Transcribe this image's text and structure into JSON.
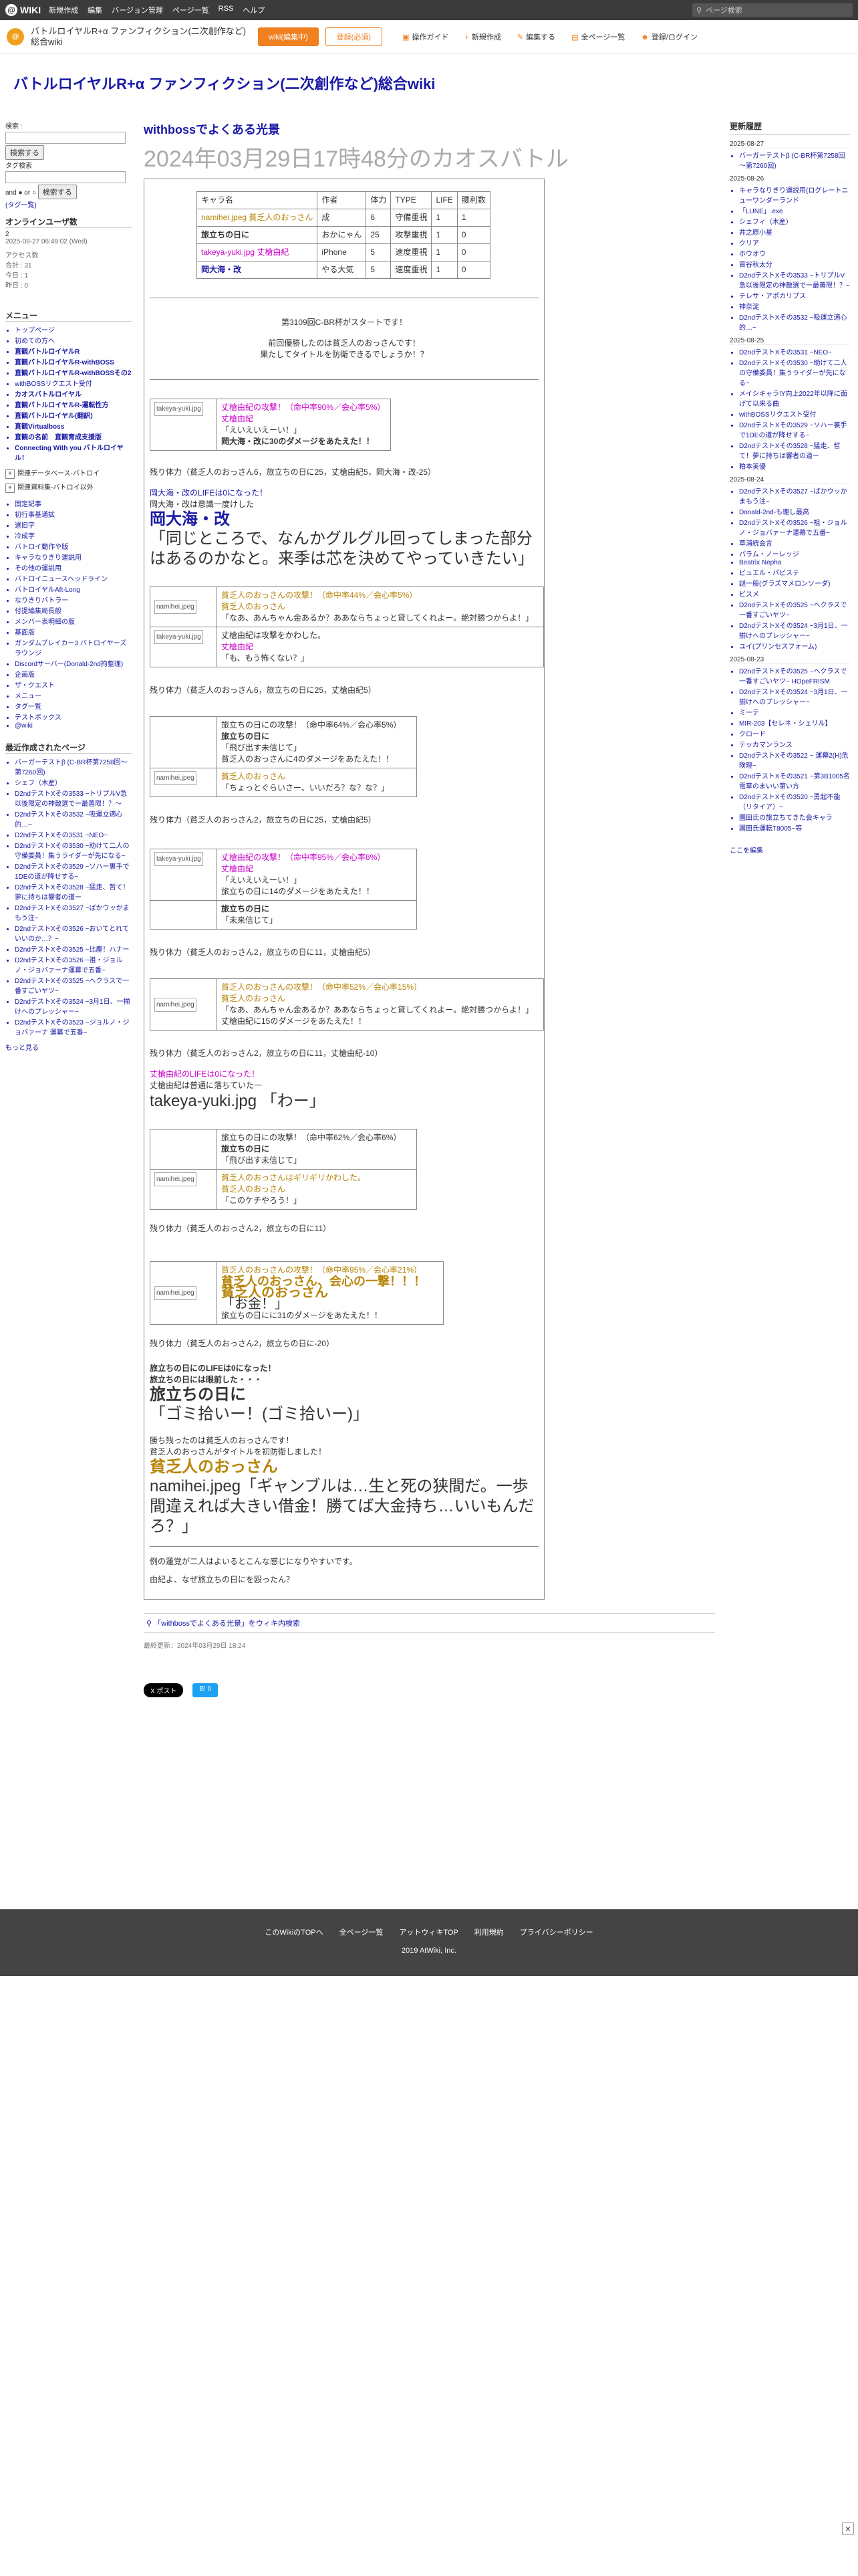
{
  "topbar": {
    "logo": "WIKI",
    "menu": [
      "新規作成",
      "編集",
      "バージョン管理",
      "ページ一覧",
      "RSS",
      "ヘルプ"
    ],
    "search_placeholder": "ページ検索"
  },
  "header": {
    "site_name": "バトルロイヤルR+α ファンフィクション(二次創作など)総合wiki",
    "edit_button": "wiki(編集中)",
    "login_button": "登録(必須)",
    "actions": [
      "操作ガイド",
      "新規作成",
      "編集する",
      "全ページ一覧",
      "登録/ログイン"
    ]
  },
  "site_title": "バトルロイヤルR+α ファンフィクション(二次創作など)総合wiki",
  "left": {
    "search_label": "検索 :",
    "search_button": "検索する",
    "tag_label": "タグ検索",
    "andor": "and ● or ○",
    "tag_button": "検索する",
    "tag_link": "(タグ一覧)",
    "online_head": "オンラインユーザ数",
    "online_value": "2",
    "online_time": "2025-08-27 06:49:02 (Wed)",
    "access_head": "アクセス数",
    "access_lines": [
      "合計 : 31",
      "今日 : 1",
      "昨日 : 0"
    ],
    "menu_head": "メニュー",
    "menu_items": [
      {
        "t": "トップページ",
        "b": false
      },
      {
        "t": "初めての方へ",
        "b": false
      },
      {
        "t": "直観バトルロイヤルR",
        "b": true
      },
      {
        "t": "直観バトルロイヤルR-withBOSS",
        "b": true
      },
      {
        "t": "直観バトルロイヤルR-withBOSSその2",
        "b": true
      },
      {
        "t": "withBOSSリクエスト受付",
        "b": false
      },
      {
        "t": "カオスバトルロイヤル",
        "b": true
      },
      {
        "t": "直観バトルロイヤルR-運転性方",
        "b": true
      },
      {
        "t": "直観バトルロイヤル(翻訳)",
        "b": true
      },
      {
        "t": "直観Virtualboss",
        "b": true
      },
      {
        "t": "直観の名前　直観育成支援版",
        "b": true
      },
      {
        "t": "Connecting With you バトルロイヤル！",
        "b": true
      }
    ],
    "box_items": [
      "関連データベース-バトロイ",
      "関連資料集-バトロイ以外"
    ],
    "tree_items": [
      "固定記事",
      "初行事基通拡",
      "選旧字",
      "冷成字",
      "バトロイ動作や版",
      "キャラなりきり運説用",
      "その他の運説用",
      "バトロイニュースヘッドライン",
      "バトロイヤルAft-Long",
      "なりきりバトラー",
      "付提編集局長般",
      "メンバー表明細の版",
      "基面版",
      "ガンダムブレイカー3 バトロイヤーズラウンジ",
      "Discordサーバー(Donald-2nd拘整理)",
      "企画版",
      "ザ・クエスト",
      "メニュー",
      "タグ一覧",
      "テストボックス",
      "@wiki"
    ],
    "recent_head": "最近作成されたページ",
    "recent_items": [
      "バーガーテストβ (C-BR杯第7258回～第7260回)",
      "シェフ（木産）",
      "D2ndテストXその3533 ~トリプルV急以後限定の神敵選でー最善限！？～",
      "D2ndテストXその3532 ~吸運立適心的…~",
      "D2ndテストXその3531 ~NEO~",
      "D2ndテストXその3530 ~助けて二人の守備委員！集うライダーが先になる~",
      "D2ndテストXその3529 ~ソハー裏手で1DEの道が降せする~",
      "D2ndテストXその3528 ~猛走、哲て！夢に持ちは響者の道ー",
      "D2ndテストXその3527 ~ばかウッかまもう注~",
      "D2ndテストXその3526 ~おいてとれていいのか…？~",
      "D2ndテストXその3525 ~比塵！ハナー",
      "D2ndテストXその3526 ~祖・ジョルノ・ジョバァーナ運幕で五番~",
      "D2ndテストXその3525 ~ヘクラスで一番すごいヤツ~",
      "D2ndテストXその3524 ~3月1日、一揃けへのプレッシャー~",
      "D2ndテストXその3523 ~ジョルノ・ジョバァーナ 運幕で五番~"
    ],
    "more": "もっと見る"
  },
  "main": {
    "keyword": "withbossでよくある光景",
    "subtitle": "2024年03月29日17時48分のカオスバトル",
    "table_head": [
      "キャラ名",
      "作者",
      "体力",
      "TYPE",
      "LIFE",
      "腰利数"
    ],
    "table_rows": [
      [
        "namihei.jpeg 貧乏人のおっさん",
        "成",
        "6",
        "守備重視",
        "1",
        "1"
      ],
      [
        "旅立ちの日に",
        "おかにゃん",
        "25",
        "攻撃重視",
        "1",
        "0"
      ],
      [
        "takeya-yuki.jpg 丈槍由紀",
        "iPhone",
        "5",
        "速度重視",
        "1",
        "0"
      ],
      [
        "岡大海・改",
        "やる大気",
        "5",
        "速度重視",
        "1",
        "0"
      ]
    ],
    "intro1": "第3109回C-BR杯がスタートです！",
    "intro2": "前回優勝したのは貧乏人のおっさんです！",
    "intro3": "果たしてタイトルを防衛できるでしょうか！？",
    "b1_attack": "丈槍由紀の攻撃！（命中率90%／会心率5%）",
    "b1_name": "丈槍由紀",
    "b1_line": "「えいえいえーい！」",
    "b1_dmg": "岡大海・改に30のダメージをあたえた！！",
    "b1_rem": "残り体力（貧乏人のおっさん6，旅立ちの日に25，丈槍由紀5，岡大海・改-25）",
    "b1_ko": "岡大海・改のLIFEは0になった！",
    "b1_ko2": "岡大海・改は意識一度けした",
    "b1_big_name": "岡大海・改",
    "b1_big_line": "「同じところで、なんかグルグル回ってしまった部分はあるのかなと。来季は芯を決めてやっていきたい」",
    "b2_attack": "貧乏人のおっさんの攻撃！（命中率44%／会心率5%）",
    "b2_name": "貧乏人のおっさん",
    "b2_line": "「なあ、あんちゃん金あるか？ああならちょっと貸してくれよー。絶対勝つからよ！」",
    "b2_miss": "丈槍由紀は攻撃をかわした。",
    "b2_name2": "丈槍由紀",
    "b2_line2": "「も、もう怖くない？」",
    "b2_rem": "残り体力（貧乏人のおっさん6，旅立ちの日に25，丈槍由紀5）",
    "b3_attack": "旅立ちの日にの攻撃！（命中率64%／会心率5%）",
    "b3_name": "旅立ちの日に",
    "b3_line": "「飛び出す未信じて」",
    "b3_dmg": "貧乏人のおっさんに4のダメージをあたえた！！",
    "b3_name2": "貧乏人のおっさん",
    "b3_line2": "「ちょっとぐらいさー、いいだろ？な？な？」",
    "b3_rem": "残り体力（貧乏人のおっさん2，旅立ちの日に25，丈槍由紀5）",
    "b4_attack": "丈槍由紀の攻撃！（命中率95%／会心率8%）",
    "b4_name": "丈槍由紀",
    "b4_line": "「えいえいえーい！」",
    "b4_dmg": "旅立ちの日に14のダメージをあたえた！！",
    "b4_name2": "旅立ちの日に",
    "b4_line2": "「未来信じて」",
    "b4_rem": "残り体力（貧乏人のおっさん2，旅立ちの日に11，丈槍由紀5）",
    "b5_attack": "貧乏人のおっさんの攻撃！（命中率52%／会心率15%）",
    "b5_name": "貧乏人のおっさん",
    "b5_line": "「なあ、あんちゃん金あるか？ああならちょっと貸してくれよー。絶対勝つからよ！」",
    "b5_dmg": "丈槍由紀に15のダメージをあたえた！！",
    "b5_rem": "残り体力（貧乏人のおっさん2，旅立ちの日に11，丈槍由紀-10）",
    "b5_ko": "丈槍由紀のLIFEは0になった！",
    "b5_ko2": "丈槍由紀は普通に落ちていた一",
    "b5_big": "takeya-yuki.jpg 「わー」",
    "b6_attack": "旅立ちの日にの攻撃！（命中率62%／会心率6%）",
    "b6_name": "旅立ちの日に",
    "b6_line": "「飛び出す未信じて」",
    "b6_miss": "貧乏人のおっさんはギリギリかわした。",
    "b6_name2": "貧乏人のおっさん",
    "b6_line2": "「このケチやろう！」",
    "b6_rem": "残り体力（貧乏人のおっさん2，旅立ちの日に11）",
    "b7_attack": "貧乏人のおっさんの攻撃！（命中率95%／会心率21%）",
    "b7_crit": "貧乏人のおっさん、会心の一撃！！！",
    "b7_big_name": "貧乏人のおっさん",
    "b7_big_line": "「お金！」",
    "b7_dmg": "旅立ちの日にに31のダメージをあたえた！！",
    "b7_rem": "残り体力（貧乏人のおっさん2，旅立ちの日に-20）",
    "end_ko": "旅立ちの日にのLIFEは0になった！",
    "end_ko2": "旅立ちの日には眼前した・・・",
    "end_big_name": "旅立ちの日に",
    "end_big_line": "「ゴミ拾いー！(ゴミ拾いー)」",
    "win1": "勝ち残ったのは貧乏人のおっさんです！",
    "win2": "貧乏人のおっさんがタイトルを初防衛しました！",
    "win_big_name": "貧乏人のおっさん",
    "win_big_line": "namihei.jpeg「ギャンブルは…生と死の狭間だ。一歩間違えれば大きい借金！勝てば大金持ち…いいもんだろ？」",
    "comment1": "例の蓮覚が二人はよいるとこんな感じになりやすいです。",
    "comment2": "由紀よ、なぜ旅立ちの日にを殴ったん？",
    "search_link": "「withbossでよくある光景」をウィキ内検索",
    "last_update": "最終更新：2024年03月29日 18:24",
    "share1": "X ポスト",
    "share2": "B! 0"
  },
  "right": {
    "head": "更新履歴",
    "groups": [
      {
        "date": "2025-08-27",
        "items": [
          "バーガーテストβ (C-BR杯第7258回～第7260回)"
        ]
      },
      {
        "date": "2025-08-26",
        "items": [
          "キャラなりきり運説用(ログレートニューワンダーランド",
          "「LUNE」.exe",
          "シェフィ（木産）",
          "井之原小星",
          "クリア",
          "ホウオウ",
          "首谷秋太分",
          "D2ndテストXその3533 ~トリプルV急以後限定の神敵選でー最善限！？~",
          "テレサ・アポカリプス",
          "神奈淀",
          "D2ndテストXその3532 ~吸運立適心的…~"
        ]
      },
      {
        "date": "2025-08-25",
        "items": [
          "D2ndテストXその3531 ~NEO~",
          "D2ndテストXその3530 ~助けて二人の守備委員！集うライダーが先になる~",
          "メイシキャラ!Y向上2022年以降に面げて以来る曲",
          "withBOSSリクエスト受付",
          "D2ndテストXその3529 ~ソハー裏手で1DEの道が降せする~",
          "D2ndテストXその3528 ~猛走、哲て！夢に持ちは響者の道ー",
          "粕本美優"
        ]
      },
      {
        "date": "2025-08-24",
        "items": [
          "D2ndテストXその3527 ~ばかウッかまもう注~",
          "Donald-2nd-も理し最高",
          "D2ndテストXその3526 ~祖・ジョルノ・ジョバァーナ運幕で五番~",
          "草浦統会言",
          "パラム・ノーレッジ",
          "Beatrix Nepha",
          "ビュエル・パビステ",
          "謎一般(グラズマメロンソーダ)",
          "ビスメ",
          "D2ndテストXその3525 ~ヘクラスで一番すごいヤツ~",
          "D2ndテストXその3524 ~3月1日、一揃けへのプレッシャー~",
          "ユイ(プリンセスフォーム)"
        ]
      },
      {
        "date": "2025-08-23",
        "items": [
          "D2ndテストXその3525 ~ヘクラスで一番すごいヤツ~ HOpeFRISM",
          "D2ndテストXその3524 ~3月1日、一揃けへのプレッシャー~",
          "ミーテ",
          "MIR-203【セレネ・シェリル】",
          "クロード",
          "テッカマンランス",
          "D2ndテストXその3522 ~ 運幕2(H)危険理~",
          "D2ndテストXその3521 ~第3B1005名電草のまいい第い方",
          "D2ndテストXその3520 ~勇起不能（リタイア）~",
          "園田氏の旅立ちてきた会キャラ",
          "園田氏運転T8005~等"
        ]
      }
    ],
    "more": "ここを編集"
  },
  "footer": {
    "links": [
      "このWikiのTOPへ",
      "全ページ一覧",
      "アットウィキTOP",
      "利用規約",
      "プライバシーポリシー"
    ],
    "copyright": "2019 AtWiki, Inc."
  }
}
